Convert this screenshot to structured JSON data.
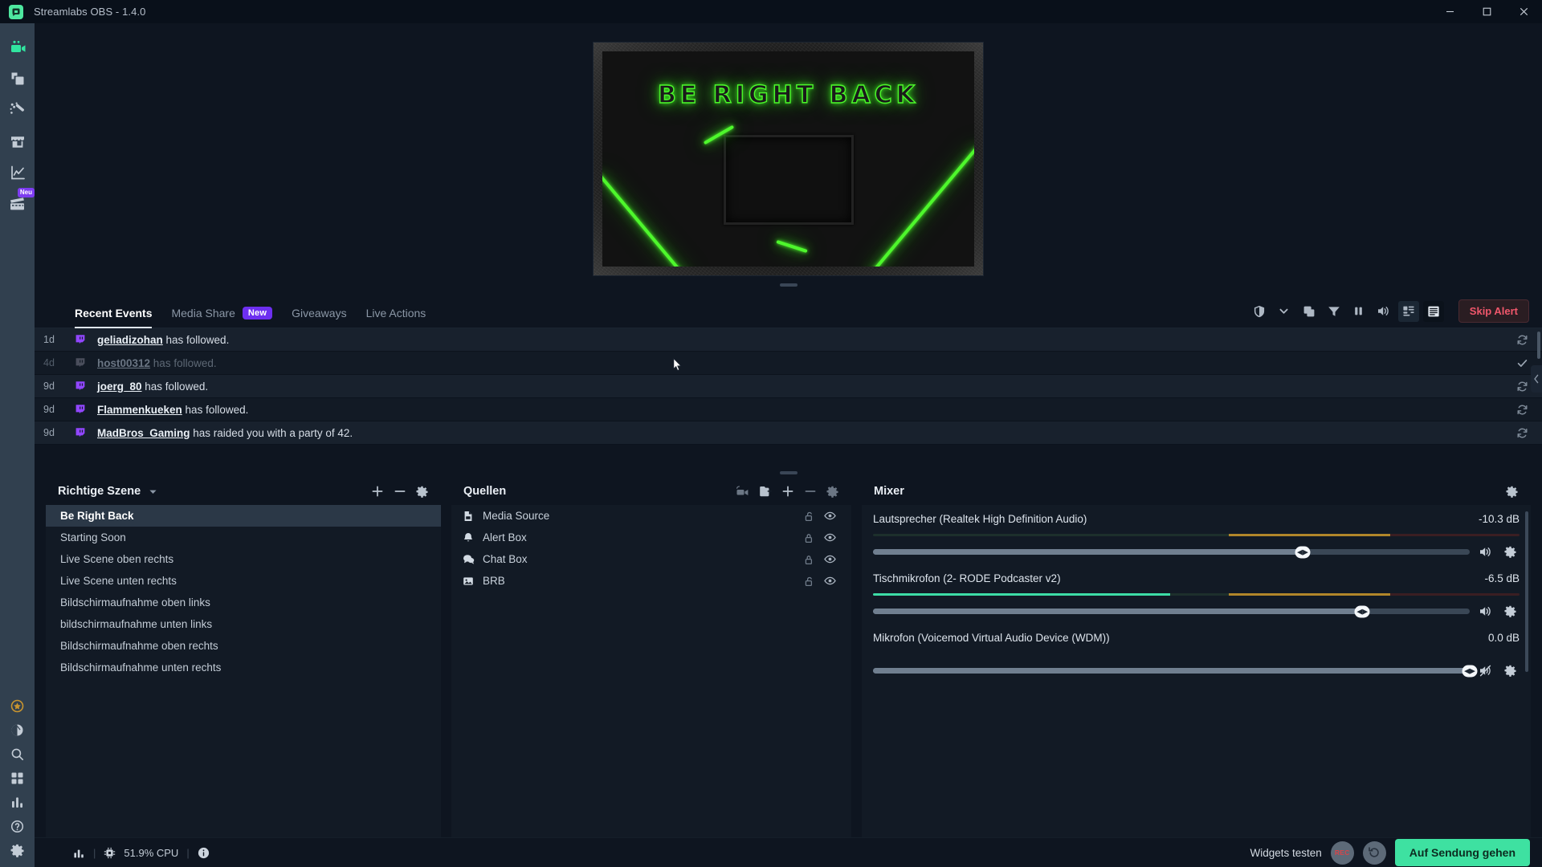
{
  "window": {
    "title": "Streamlabs OBS - 1.4.0",
    "logo_icon": "streamlabs-logo-icon",
    "minimize_icon": "minimize-icon",
    "maximize_icon": "maximize-icon",
    "close_icon": "close-icon"
  },
  "leftnav": {
    "items": [
      {
        "name": "editor",
        "icon": "video-camera-icon",
        "active": true,
        "badge": ""
      },
      {
        "name": "layout-editor",
        "icon": "layers-icon",
        "active": false,
        "badge": ""
      },
      {
        "name": "themes",
        "icon": "magic-wand-icon",
        "active": false,
        "badge": ""
      },
      {
        "name": "store",
        "icon": "store-icon",
        "active": false,
        "badge": ""
      },
      {
        "name": "dashboard",
        "icon": "line-chart-icon",
        "active": false,
        "badge": ""
      },
      {
        "name": "highlighter",
        "icon": "film-clapper-icon",
        "active": false,
        "badge": "Neu"
      }
    ],
    "bottom_items": [
      {
        "name": "prime",
        "icon": "prime-crown-icon"
      },
      {
        "name": "night-mode",
        "icon": "moon-icon"
      },
      {
        "name": "search",
        "icon": "search-icon"
      },
      {
        "name": "grid",
        "icon": "grid-icon"
      },
      {
        "name": "stats",
        "icon": "bar-chart-icon"
      },
      {
        "name": "help",
        "icon": "question-circle-icon"
      },
      {
        "name": "settings",
        "icon": "gear-icon"
      }
    ],
    "badge_color": "#6d2ff0",
    "active_color": "#31e6a0"
  },
  "preview": {
    "scene_title": "BE RIGHT BACK",
    "neon_color": "#4ef72c",
    "resize_handle": "preview-resize-handle"
  },
  "events": {
    "tabs": [
      {
        "label": "Recent Events",
        "active": true,
        "badge": ""
      },
      {
        "label": "Media Share",
        "active": false,
        "badge": "New"
      },
      {
        "label": "Giveaways",
        "active": false,
        "badge": ""
      },
      {
        "label": "Live Actions",
        "active": false,
        "badge": ""
      }
    ],
    "toolbar": [
      {
        "name": "shield-icon",
        "boxed": false
      },
      {
        "name": "chevron-down-icon",
        "boxed": false
      },
      {
        "name": "copy-icon",
        "boxed": false
      },
      {
        "name": "filter-icon",
        "boxed": false
      },
      {
        "name": "pause-icon",
        "boxed": false
      },
      {
        "name": "volume-icon",
        "boxed": false
      },
      {
        "name": "grid-view-icon",
        "boxed": true
      },
      {
        "name": "list-view-icon",
        "boxed": true
      }
    ],
    "skip_alert_label": "Skip Alert",
    "skip_alert_color": "#f0576b",
    "rows": [
      {
        "time": "1d",
        "user": "geliadizohan",
        "text": " has followed.",
        "platform": "twitch-icon",
        "read": false,
        "action": "refresh-icon"
      },
      {
        "time": "4d",
        "user": "host00312",
        "text": " has followed.",
        "platform": "twitch-icon",
        "read": true,
        "action": "check-icon"
      },
      {
        "time": "9d",
        "user": "joerg_80",
        "text": " has followed.",
        "platform": "twitch-icon",
        "read": false,
        "action": "refresh-icon"
      },
      {
        "time": "9d",
        "user": "Flammenkueken",
        "text": " has followed.",
        "platform": "twitch-icon",
        "read": false,
        "action": "refresh-icon"
      },
      {
        "time": "9d",
        "user": "MadBros_Gaming",
        "text": " has raided you with a party of 42.",
        "platform": "twitch-icon",
        "read": false,
        "action": "refresh-icon"
      }
    ]
  },
  "scenes": {
    "title": "Richtige Szene",
    "tools": [
      {
        "name": "add-scene-button",
        "icon": "plus-icon"
      },
      {
        "name": "remove-scene-button",
        "icon": "minus-icon"
      },
      {
        "name": "scene-settings-button",
        "icon": "gear-icon"
      }
    ],
    "items": [
      {
        "label": "Be Right Back",
        "selected": true
      },
      {
        "label": "Starting Soon",
        "selected": false
      },
      {
        "label": "Live Scene oben rechts",
        "selected": false
      },
      {
        "label": "Live Scene unten rechts",
        "selected": false
      },
      {
        "label": "Bildschirmaufnahme oben links",
        "selected": false
      },
      {
        "label": "bildschirmaufnahme unten links",
        "selected": false
      },
      {
        "label": "Bildschirmaufnahme oben rechts",
        "selected": false
      },
      {
        "label": "Bildschirmaufnahme unten rechts",
        "selected": false
      }
    ]
  },
  "sources": {
    "title": "Quellen",
    "tools": [
      {
        "name": "projector-button",
        "icon": "projector-icon"
      },
      {
        "name": "group-sources-button",
        "icon": "folder-add-icon"
      },
      {
        "name": "add-source-button",
        "icon": "plus-icon"
      },
      {
        "name": "remove-source-button",
        "icon": "minus-icon"
      },
      {
        "name": "source-settings-button",
        "icon": "gear-icon"
      }
    ],
    "items": [
      {
        "label": "Media Source",
        "icon": "media-file-icon",
        "locked": false,
        "visible": true
      },
      {
        "label": "Alert Box",
        "icon": "bell-icon",
        "locked": true,
        "visible": true
      },
      {
        "label": "Chat Box",
        "icon": "chat-bubble-icon",
        "locked": true,
        "visible": true
      },
      {
        "label": "BRB",
        "icon": "image-icon",
        "locked": false,
        "visible": true
      }
    ]
  },
  "mixer": {
    "title": "Mixer",
    "settings_icon": "gear-icon",
    "channels": [
      {
        "name": "Lautsprecher (Realtek High Definition Audio)",
        "db": "-10.3 dB",
        "volume_pct": 72,
        "meter_green_pct": 0,
        "meter_yellow_pct": 45,
        "muted": false,
        "mute_icon": "volume-icon",
        "settings_icon": "gear-icon"
      },
      {
        "name": "Tischmikrofon (2- RODE Podcaster v2)",
        "db": "-6.5 dB",
        "volume_pct": 82,
        "meter_green_pct": 46,
        "meter_yellow_pct": 26,
        "muted": false,
        "mute_icon": "volume-icon",
        "settings_icon": "gear-icon"
      },
      {
        "name": "Mikrofon (Voicemod Virtual Audio Device (WDM))",
        "db": "0.0 dB",
        "volume_pct": 100,
        "meter_green_pct": 0,
        "meter_yellow_pct": 0,
        "muted": true,
        "mute_icon": "volume-muted-icon",
        "settings_icon": "gear-icon"
      }
    ]
  },
  "statusbar": {
    "stats_icon": "bar-chart-icon",
    "cpu_icon": "cpu-chip-icon",
    "cpu_text": "51.9% CPU",
    "info_icon": "info-circle-icon",
    "widgets_label": "Widgets testen",
    "record_label": "REC",
    "replay_icon": "replay-buffer-icon",
    "go_live_label": "Auf Sendung gehen",
    "go_live_color": "#3ee1a1"
  }
}
